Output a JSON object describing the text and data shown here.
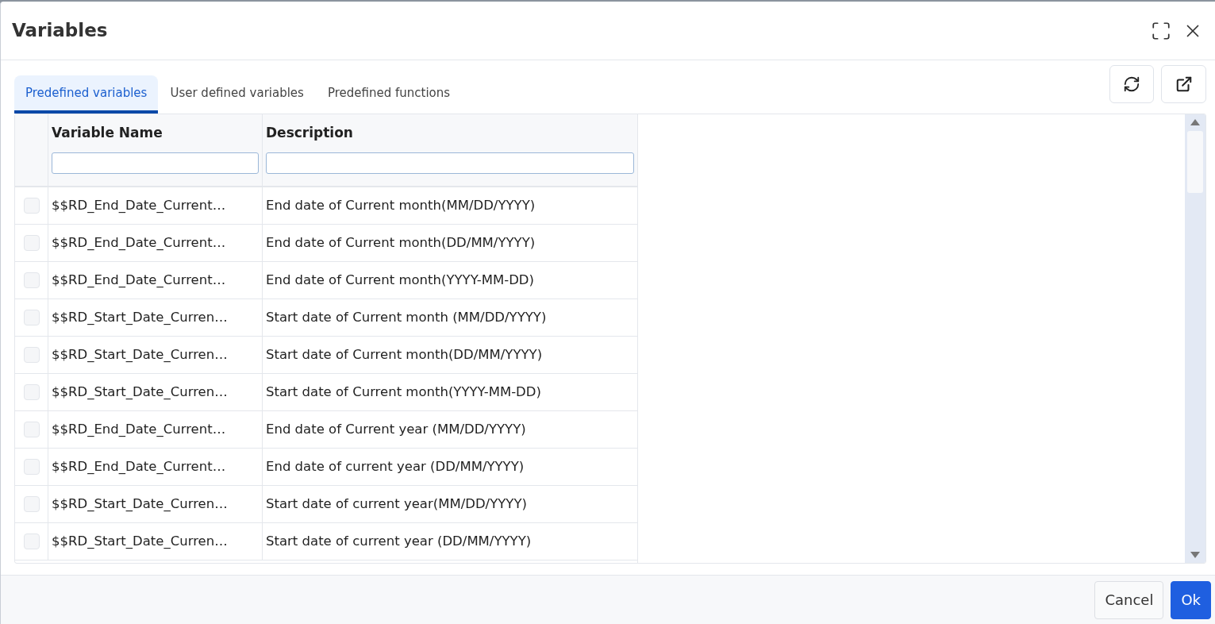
{
  "dialog": {
    "title": "Variables"
  },
  "tabs": [
    {
      "label": "Predefined variables",
      "selected": true
    },
    {
      "label": "User defined variables",
      "selected": false
    },
    {
      "label": "Predefined functions",
      "selected": false
    }
  ],
  "table": {
    "columns": [
      {
        "label": "Variable Name"
      },
      {
        "label": "Description"
      }
    ],
    "rows": [
      {
        "checked": false,
        "name": "$$RD_End_Date_Current…",
        "description": "End date of Current month(MM/DD/YYYY)"
      },
      {
        "checked": false,
        "name": "$$RD_End_Date_Current…",
        "description": "End date of Current month(DD/MM/YYYY)"
      },
      {
        "checked": false,
        "name": "$$RD_End_Date_Current…",
        "description": "End date of Current month(YYYY-MM-DD)"
      },
      {
        "checked": false,
        "name": "$$RD_Start_Date_Curren…",
        "description": "Start date of Current month (MM/DD/YYYY)"
      },
      {
        "checked": false,
        "name": "$$RD_Start_Date_Curren…",
        "description": "Start date of Current month(DD/MM/YYYY)"
      },
      {
        "checked": false,
        "name": "$$RD_Start_Date_Curren…",
        "description": "Start date of Current month(YYYY-MM-DD)"
      },
      {
        "checked": false,
        "name": "$$RD_End_Date_Current…",
        "description": "End date of Current year (MM/DD/YYYY)"
      },
      {
        "checked": false,
        "name": "$$RD_End_Date_Current…",
        "description": "End date of current year (DD/MM/YYYY)"
      },
      {
        "checked": false,
        "name": "$$RD_Start_Date_Curren…",
        "description": "Start date of current year(MM/DD/YYYY)"
      },
      {
        "checked": false,
        "name": "$$RD_Start_Date_Curren…",
        "description": "Start date of current year (DD/MM/YYYY)"
      }
    ]
  },
  "footer": {
    "buttons": [
      {
        "label": "Cancel",
        "kind": "secondary"
      },
      {
        "label": "Ok",
        "kind": "primary"
      }
    ]
  }
}
